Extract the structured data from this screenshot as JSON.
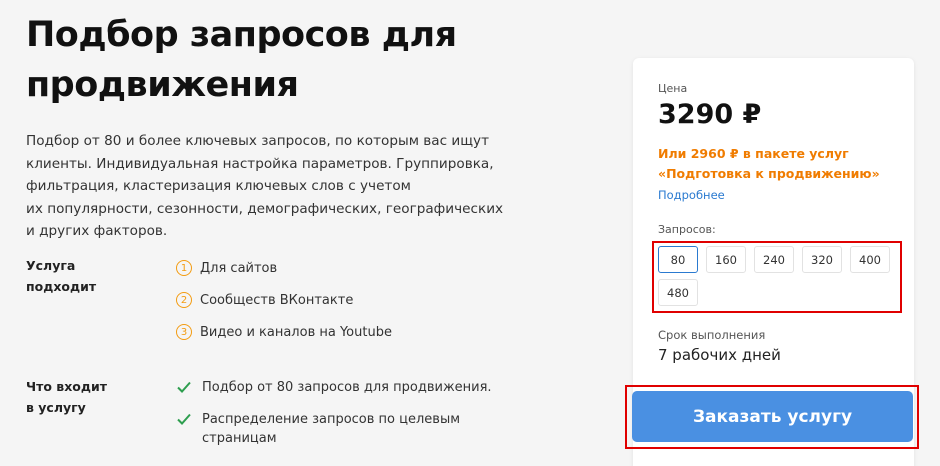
{
  "page": {
    "title": "Подбор запросов для продвижения",
    "description": "Подбор от 80 и более ключевых запросов, по которым вас ищут\nклиенты. Индивидуальная настройка параметров. Группировка,\nфильтрация, кластеризация ключевых слов с учетом\nих популярности, сезонности, демографических, географических\nи других факторов."
  },
  "suits": {
    "label": "Услуга\nподходит",
    "items": [
      {
        "num": "1",
        "text": "Для сайтов"
      },
      {
        "num": "2",
        "text": "Сообществ ВКонтакте"
      },
      {
        "num": "3",
        "text": "Видео и каналов на Youtube"
      }
    ]
  },
  "includes": {
    "label": "Что входит\nв услугу",
    "items": [
      {
        "text": "Подбор от 80 запросов для продвижения."
      },
      {
        "text": "Распределение запросов по целевым\nстраницам"
      }
    ]
  },
  "card": {
    "price_label": "Цена",
    "price": "3290 ₽",
    "package_text": "Или 2960 ₽ в пакете услуг\n«Подготовка к продвижению»",
    "more_link": "Подробнее",
    "requests_label": "Запросов:",
    "requests": [
      "80",
      "160",
      "240",
      "320",
      "400",
      "480"
    ],
    "selected_request": "80",
    "deadline_label": "Срок выполнения",
    "deadline_value": "7 рабочих дней",
    "order_button": "Заказать услугу"
  },
  "colors": {
    "accent_blue": "#4a90e2",
    "accent_orange": "#f07c00",
    "check_green": "#2e9e4f",
    "highlight_red": "#e00000"
  }
}
